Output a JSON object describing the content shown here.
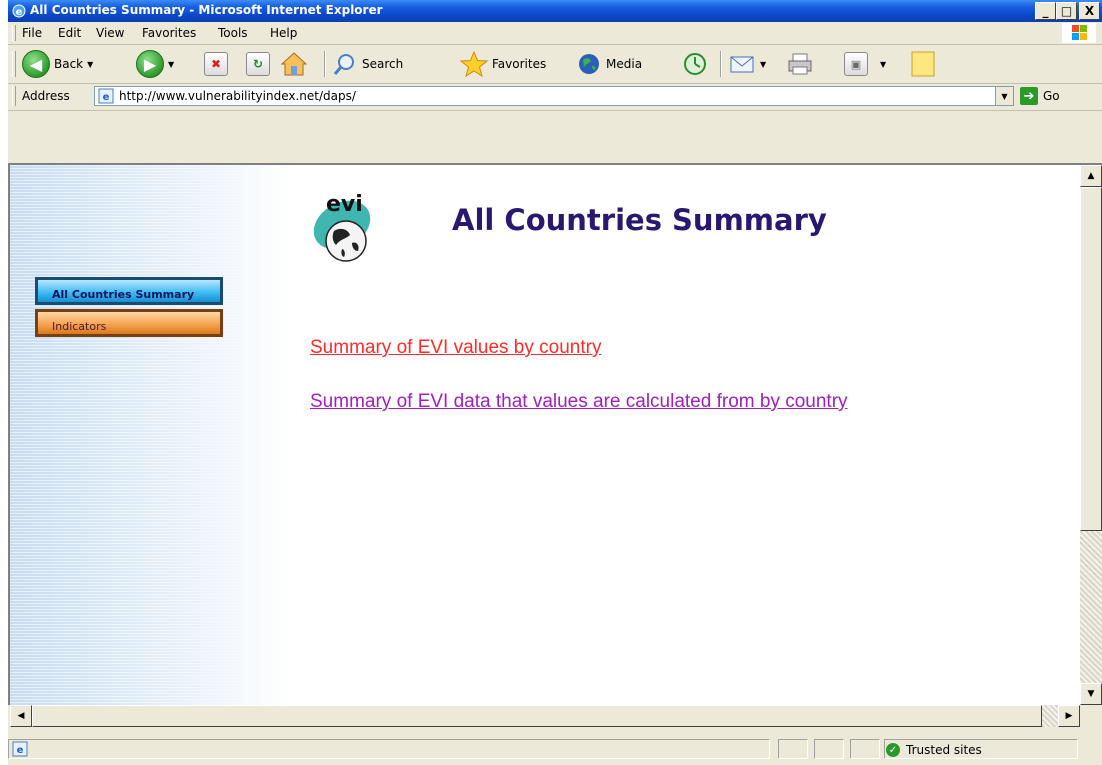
{
  "window": {
    "title": "All Countries Summary - Microsoft Internet Explorer",
    "min_label": "_",
    "max_label": "□",
    "close_label": "X"
  },
  "menu": [
    {
      "label": "File"
    },
    {
      "label": "Edit"
    },
    {
      "label": "View"
    },
    {
      "label": "Favorites"
    },
    {
      "label": "Tools"
    },
    {
      "label": "Help"
    }
  ],
  "toolbar": {
    "back": "Back",
    "search": "Search",
    "favorites": "Favorites",
    "media": "Media"
  },
  "address": {
    "label": "Address",
    "url": "http://www.vulnerabilityindex.net/daps/",
    "go": "Go"
  },
  "page": {
    "logo_text": "evi",
    "title": "All Countries Summary",
    "nav": [
      {
        "label": "All Countries Summary"
      },
      {
        "label": "Indicators"
      }
    ],
    "links": [
      {
        "label": "Summary of EVI values by country",
        "color": "#ff2a2a"
      },
      {
        "label": "Summary of EVI data that values are calculated from by country",
        "color": "#a020c0"
      }
    ]
  },
  "status": {
    "zone": "Trusted sites"
  }
}
